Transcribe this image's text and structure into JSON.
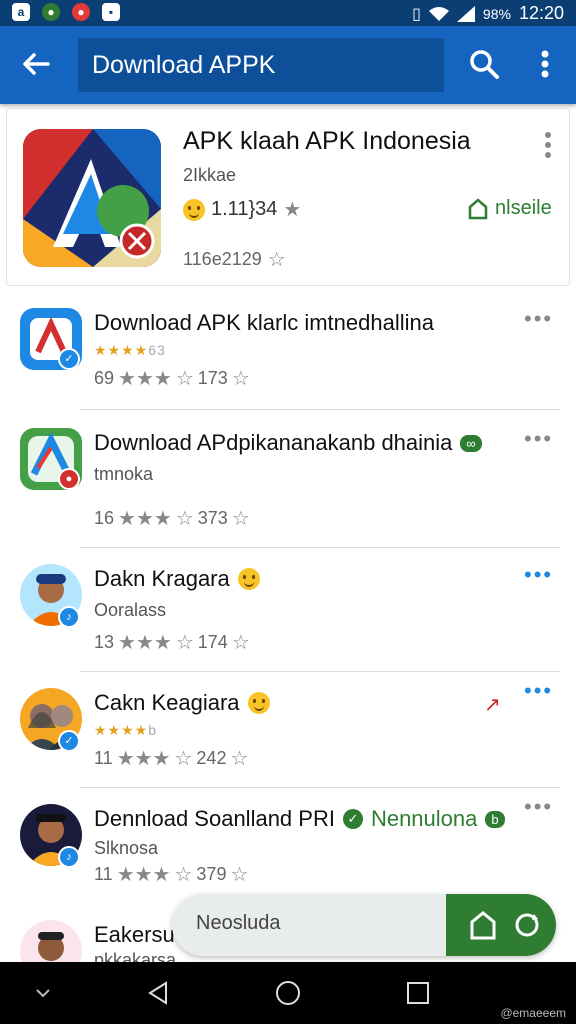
{
  "statusbar": {
    "time": "12:20",
    "battery": "98%"
  },
  "appbar": {
    "search_query": "Download APPK"
  },
  "featured": {
    "title": "APK klaah APK Indonesia",
    "subtitle": "2Ikkae",
    "rating": "1.11}34",
    "count": "116e2129",
    "install_label": "nlseile"
  },
  "apps": [
    {
      "title": "Download APK klarlc imtnedhallina",
      "stars": "★★★★",
      "stars_extra": "63",
      "meta_left": "69",
      "meta_right": "173"
    },
    {
      "title": "Download APdpikananakanb dhainia",
      "subtitle": "tmnoka",
      "meta_left": "16",
      "meta_right": "373"
    },
    {
      "title": "Dakn Kragara",
      "subtitle": "Ooralass",
      "meta_left": "13",
      "meta_right": "174"
    },
    {
      "title": "Cakn Keagiara",
      "stars": "★★★★",
      "stars_extra": "b",
      "meta_left": "11",
      "meta_right": "242"
    },
    {
      "title": "Dennload Soanlland PRI",
      "title_extra": "Nennulona",
      "subtitle": "Slknosa",
      "meta_left": "11",
      "meta_right": "379"
    },
    {
      "title": "Eakersu",
      "subtitle": "pkkakarsa"
    }
  ],
  "floatbar": {
    "text": "Neosluda"
  },
  "navbar": {
    "watermark": "@emaeeem"
  },
  "colors": {
    "appbar": "#1565c0",
    "statusbar": "#0b3f73",
    "accent_green": "#2e7d32",
    "star_gold": "#e2a21b"
  }
}
